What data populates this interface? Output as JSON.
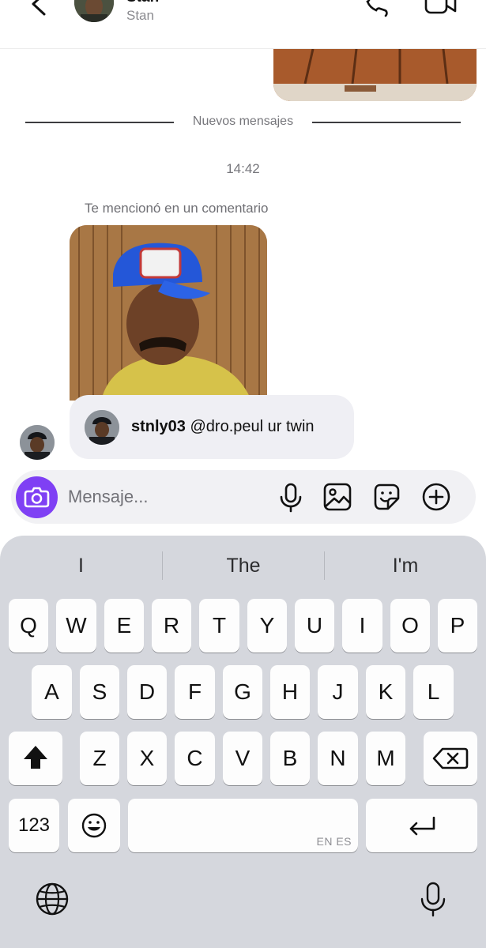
{
  "header": {
    "contact_name": "Stan",
    "contact_subtitle": "Stan",
    "icons": [
      "chevron-left-icon",
      "phone-icon",
      "video-camera-icon"
    ]
  },
  "chat": {
    "divider_label": "Nuevos mensajes",
    "timestamp": "14:42",
    "mention_label": "Te mencionó en un comentario",
    "comment": {
      "username": "stnly03",
      "text": "@dro.peul ur twin"
    }
  },
  "composer": {
    "placeholder": "Mensaje...",
    "icons": [
      "camera-icon",
      "microphone-icon",
      "image-icon",
      "sticker-icon",
      "plus-circle-icon"
    ],
    "accent_color": "#7f40f4"
  },
  "keyboard": {
    "suggestions": [
      "I",
      "The",
      "I'm"
    ],
    "row1": [
      "Q",
      "W",
      "E",
      "R",
      "T",
      "Y",
      "U",
      "I",
      "O",
      "P"
    ],
    "row2": [
      "A",
      "S",
      "D",
      "F",
      "G",
      "H",
      "J",
      "K",
      "L"
    ],
    "row3": [
      "Z",
      "X",
      "C",
      "V",
      "B",
      "N",
      "M"
    ],
    "numbers_key": "123",
    "language_tag": "EN ES",
    "icons": [
      "shift-icon",
      "backspace-icon",
      "emoji-icon",
      "return-icon",
      "globe-icon",
      "dictation-icon"
    ]
  }
}
